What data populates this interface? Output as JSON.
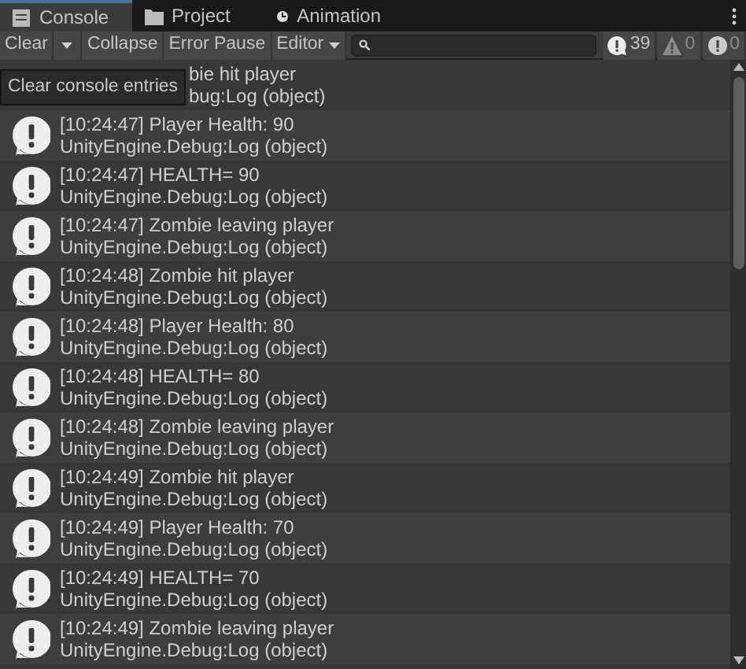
{
  "tabs": [
    {
      "label": "Console",
      "kind": "console",
      "selected": true
    },
    {
      "label": "Project",
      "kind": "folder",
      "selected": false
    },
    {
      "label": "Animation",
      "kind": "clock",
      "selected": false
    }
  ],
  "toolbar": {
    "clear": "Clear",
    "collapse": "Collapse",
    "error_pause": "Error Pause",
    "editor": "Editor",
    "counts": [
      {
        "kind": "info",
        "count": "39"
      },
      {
        "kind": "warning",
        "count": "0"
      },
      {
        "kind": "error",
        "count": "0"
      }
    ]
  },
  "tooltip": "Clear console entries",
  "entries": [
    {
      "kind": "partial",
      "message": "bie hit player",
      "source": "bug:Log (object)"
    },
    {
      "kind": "full",
      "message": "[10:24:47] Player Health: 90",
      "source": "UnityEngine.Debug:Log (object)"
    },
    {
      "kind": "full",
      "message": "[10:24:47] HEALTH= 90",
      "source": "UnityEngine.Debug:Log (object)"
    },
    {
      "kind": "full",
      "message": "[10:24:47] Zombie leaving player",
      "source": "UnityEngine.Debug:Log (object)"
    },
    {
      "kind": "full",
      "message": "[10:24:48] Zombie hit player",
      "source": "UnityEngine.Debug:Log (object)"
    },
    {
      "kind": "full",
      "message": "[10:24:48] Player Health: 80",
      "source": "UnityEngine.Debug:Log (object)"
    },
    {
      "kind": "full",
      "message": "[10:24:48] HEALTH= 80",
      "source": "UnityEngine.Debug:Log (object)"
    },
    {
      "kind": "full",
      "message": "[10:24:48] Zombie leaving player",
      "source": "UnityEngine.Debug:Log (object)"
    },
    {
      "kind": "full",
      "message": "[10:24:49] Zombie hit player",
      "source": "UnityEngine.Debug:Log (object)"
    },
    {
      "kind": "full",
      "message": "[10:24:49] Player Health: 70",
      "source": "UnityEngine.Debug:Log (object)"
    },
    {
      "kind": "full",
      "message": "[10:24:49] HEALTH= 70",
      "source": "UnityEngine.Debug:Log (object)"
    },
    {
      "kind": "full",
      "message": "[10:24:49] Zombie leaving player",
      "source": "UnityEngine.Debug:Log (object)"
    }
  ]
}
